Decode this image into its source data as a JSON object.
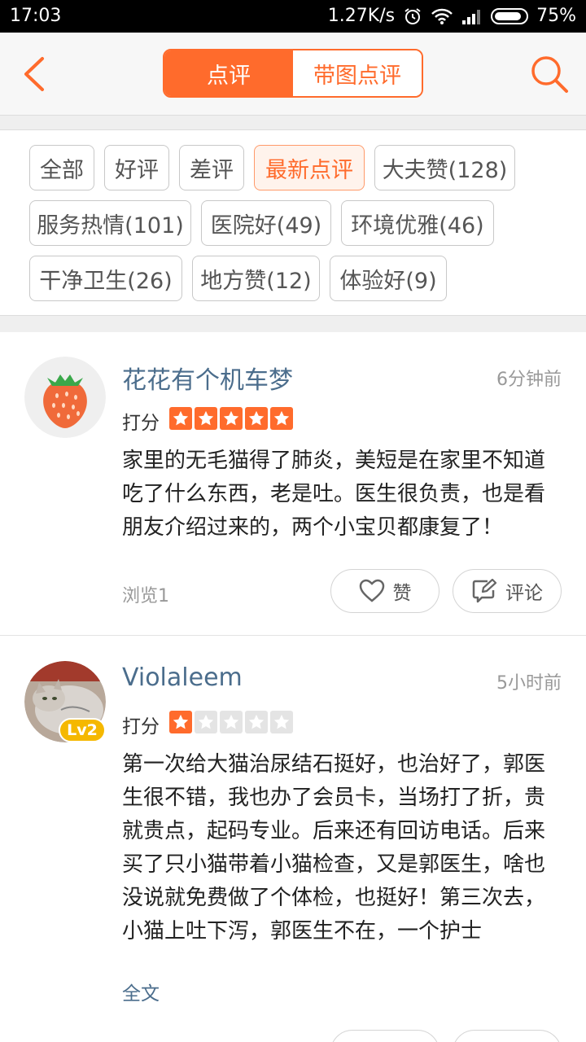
{
  "status_bar": {
    "time": "17:03",
    "speed": "1.27K/s",
    "battery": "75%"
  },
  "header": {
    "tabs": [
      {
        "label": "点评",
        "active": true
      },
      {
        "label": "带图点评",
        "active": false
      }
    ]
  },
  "filters": [
    {
      "label": "全部",
      "active": false
    },
    {
      "label": "好评",
      "active": false
    },
    {
      "label": "差评",
      "active": false
    },
    {
      "label": "最新点评",
      "active": true
    },
    {
      "label": "大夫赞(128)",
      "active": false
    },
    {
      "label": "服务热情(101)",
      "active": false
    },
    {
      "label": "医院好(49)",
      "active": false
    },
    {
      "label": "环境优雅(46)",
      "active": false
    },
    {
      "label": "干净卫生(26)",
      "active": false
    },
    {
      "label": "地方赞(12)",
      "active": false
    },
    {
      "label": "体验好(9)",
      "active": false
    }
  ],
  "reviews": [
    {
      "user": "花花有个机车梦",
      "time": "6分钟前",
      "score_label": "打分",
      "rating": 5,
      "text": "家里的无毛猫得了肺炎，美短是在家里不知道吃了什么东西，老是吐。医生很负责，也是看朋友介绍过来的，两个小宝贝都康复了！",
      "views": "浏览1",
      "like_label": "赞",
      "comment_label": "评论"
    },
    {
      "user": "Violaleem",
      "time": "5小时前",
      "level": "Lv2",
      "score_label": "打分",
      "rating": 1,
      "text": "第一次给大猫治尿结石挺好，也治好了，郭医生很不错，我也办了会员卡，当场打了折，贵就贵点，起码专业。后来还有回访电话。后来买了只小猫带着小猫检查，又是郭医生，啥也没说就免费做了个体检，也挺好！第三次去，小猫上吐下泻，郭医生不在，一个护士",
      "full_text_label": "全文"
    }
  ],
  "colors": {
    "accent": "#ff6b2c",
    "link": "#4b6d8c"
  }
}
